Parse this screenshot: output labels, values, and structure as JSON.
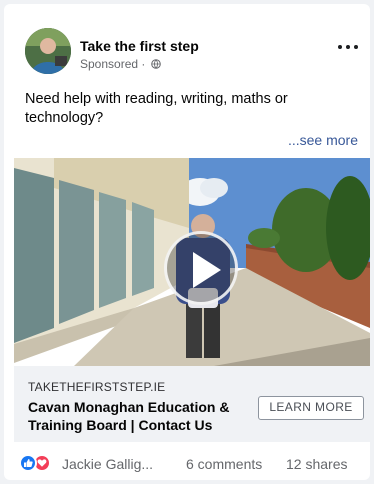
{
  "post": {
    "page_name": "Take the first step",
    "sponsored_label": "Sponsored · ",
    "text": "Need help with reading, writing, maths or technology?",
    "see_more": "...see more"
  },
  "icons": {
    "avatar": "profile-photo",
    "privacy": "globe-icon",
    "menu": "more-options-icon",
    "media_play": "play-icon",
    "reactions": [
      "like-icon",
      "love-icon"
    ]
  },
  "link_preview": {
    "domain": "TAKETHEFIRSTSTEP.IE",
    "headline": "Cavan Monaghan Education & Training Board | Contact Us",
    "cta_label": "LEARN MORE"
  },
  "engagement": {
    "reactors": "Jackie Gallig...",
    "comments": "6 comments",
    "shares": "12 shares"
  },
  "colors": {
    "like": "#1877f2",
    "love": "#f33e58",
    "link": "#385898",
    "cta_bar": "#f0f2f5"
  }
}
